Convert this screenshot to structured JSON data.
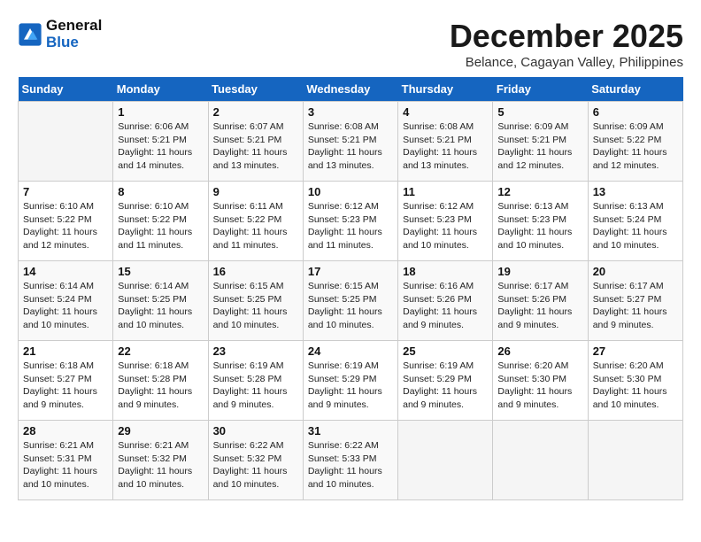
{
  "logo": {
    "line1": "General",
    "line2": "Blue"
  },
  "title": "December 2025",
  "subtitle": "Belance, Cagayan Valley, Philippines",
  "weekdays": [
    "Sunday",
    "Monday",
    "Tuesday",
    "Wednesday",
    "Thursday",
    "Friday",
    "Saturday"
  ],
  "weeks": [
    [
      {
        "day": "",
        "info": ""
      },
      {
        "day": "1",
        "info": "Sunrise: 6:06 AM\nSunset: 5:21 PM\nDaylight: 11 hours\nand 14 minutes."
      },
      {
        "day": "2",
        "info": "Sunrise: 6:07 AM\nSunset: 5:21 PM\nDaylight: 11 hours\nand 13 minutes."
      },
      {
        "day": "3",
        "info": "Sunrise: 6:08 AM\nSunset: 5:21 PM\nDaylight: 11 hours\nand 13 minutes."
      },
      {
        "day": "4",
        "info": "Sunrise: 6:08 AM\nSunset: 5:21 PM\nDaylight: 11 hours\nand 13 minutes."
      },
      {
        "day": "5",
        "info": "Sunrise: 6:09 AM\nSunset: 5:21 PM\nDaylight: 11 hours\nand 12 minutes."
      },
      {
        "day": "6",
        "info": "Sunrise: 6:09 AM\nSunset: 5:22 PM\nDaylight: 11 hours\nand 12 minutes."
      }
    ],
    [
      {
        "day": "7",
        "info": "Sunrise: 6:10 AM\nSunset: 5:22 PM\nDaylight: 11 hours\nand 12 minutes."
      },
      {
        "day": "8",
        "info": "Sunrise: 6:10 AM\nSunset: 5:22 PM\nDaylight: 11 hours\nand 11 minutes."
      },
      {
        "day": "9",
        "info": "Sunrise: 6:11 AM\nSunset: 5:22 PM\nDaylight: 11 hours\nand 11 minutes."
      },
      {
        "day": "10",
        "info": "Sunrise: 6:12 AM\nSunset: 5:23 PM\nDaylight: 11 hours\nand 11 minutes."
      },
      {
        "day": "11",
        "info": "Sunrise: 6:12 AM\nSunset: 5:23 PM\nDaylight: 11 hours\nand 10 minutes."
      },
      {
        "day": "12",
        "info": "Sunrise: 6:13 AM\nSunset: 5:23 PM\nDaylight: 11 hours\nand 10 minutes."
      },
      {
        "day": "13",
        "info": "Sunrise: 6:13 AM\nSunset: 5:24 PM\nDaylight: 11 hours\nand 10 minutes."
      }
    ],
    [
      {
        "day": "14",
        "info": "Sunrise: 6:14 AM\nSunset: 5:24 PM\nDaylight: 11 hours\nand 10 minutes."
      },
      {
        "day": "15",
        "info": "Sunrise: 6:14 AM\nSunset: 5:25 PM\nDaylight: 11 hours\nand 10 minutes."
      },
      {
        "day": "16",
        "info": "Sunrise: 6:15 AM\nSunset: 5:25 PM\nDaylight: 11 hours\nand 10 minutes."
      },
      {
        "day": "17",
        "info": "Sunrise: 6:15 AM\nSunset: 5:25 PM\nDaylight: 11 hours\nand 10 minutes."
      },
      {
        "day": "18",
        "info": "Sunrise: 6:16 AM\nSunset: 5:26 PM\nDaylight: 11 hours\nand 9 minutes."
      },
      {
        "day": "19",
        "info": "Sunrise: 6:17 AM\nSunset: 5:26 PM\nDaylight: 11 hours\nand 9 minutes."
      },
      {
        "day": "20",
        "info": "Sunrise: 6:17 AM\nSunset: 5:27 PM\nDaylight: 11 hours\nand 9 minutes."
      }
    ],
    [
      {
        "day": "21",
        "info": "Sunrise: 6:18 AM\nSunset: 5:27 PM\nDaylight: 11 hours\nand 9 minutes."
      },
      {
        "day": "22",
        "info": "Sunrise: 6:18 AM\nSunset: 5:28 PM\nDaylight: 11 hours\nand 9 minutes."
      },
      {
        "day": "23",
        "info": "Sunrise: 6:19 AM\nSunset: 5:28 PM\nDaylight: 11 hours\nand 9 minutes."
      },
      {
        "day": "24",
        "info": "Sunrise: 6:19 AM\nSunset: 5:29 PM\nDaylight: 11 hours\nand 9 minutes."
      },
      {
        "day": "25",
        "info": "Sunrise: 6:19 AM\nSunset: 5:29 PM\nDaylight: 11 hours\nand 9 minutes."
      },
      {
        "day": "26",
        "info": "Sunrise: 6:20 AM\nSunset: 5:30 PM\nDaylight: 11 hours\nand 9 minutes."
      },
      {
        "day": "27",
        "info": "Sunrise: 6:20 AM\nSunset: 5:30 PM\nDaylight: 11 hours\nand 10 minutes."
      }
    ],
    [
      {
        "day": "28",
        "info": "Sunrise: 6:21 AM\nSunset: 5:31 PM\nDaylight: 11 hours\nand 10 minutes."
      },
      {
        "day": "29",
        "info": "Sunrise: 6:21 AM\nSunset: 5:32 PM\nDaylight: 11 hours\nand 10 minutes."
      },
      {
        "day": "30",
        "info": "Sunrise: 6:22 AM\nSunset: 5:32 PM\nDaylight: 11 hours\nand 10 minutes."
      },
      {
        "day": "31",
        "info": "Sunrise: 6:22 AM\nSunset: 5:33 PM\nDaylight: 11 hours\nand 10 minutes."
      },
      {
        "day": "",
        "info": ""
      },
      {
        "day": "",
        "info": ""
      },
      {
        "day": "",
        "info": ""
      }
    ]
  ]
}
